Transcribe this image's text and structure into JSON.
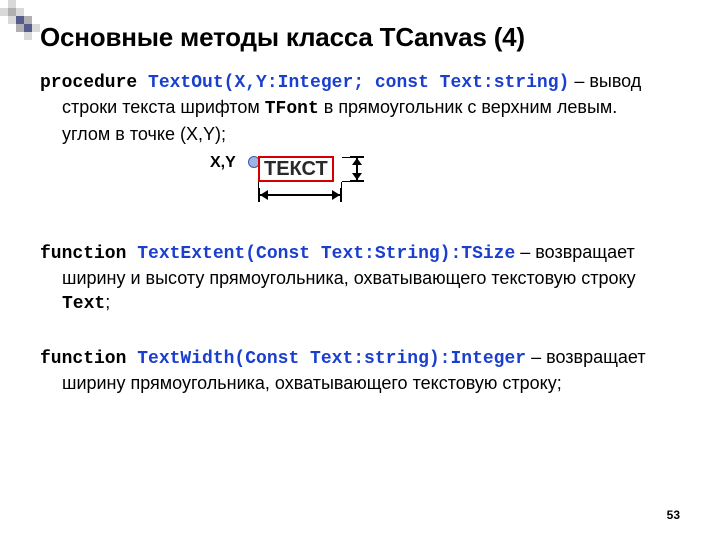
{
  "title": "Основные методы класса TCanvas (4)",
  "pagenum": "53",
  "block1": {
    "pre": "procedure ",
    "sig": "TextOut(X,Y:Integer; const Text:string)",
    "post": " – вывод",
    "line2": "строки текста шрифтом ",
    "tfont": "TFont",
    "line2b": "  в прямоугольник с верхним левым.",
    "line3": "углом в точке (X,Y);"
  },
  "diagram": {
    "xy": "X,Y",
    "text": "ТЕКСТ"
  },
  "block2": {
    "pre": "function ",
    "sig": "TextExtent(Const Text:String):TSize",
    "post": " – возвращает",
    "line2": "ширину и высоту прямоугольника, охватывающего текстовую строку",
    "code": "Text",
    "line3": ";"
  },
  "block3": {
    "pre": "function ",
    "sig": "TextWidth(Const Text:string):Integer",
    "post": " – возвращает",
    "line2": "ширину прямоугольника, охватывающего текстовую строку;"
  }
}
